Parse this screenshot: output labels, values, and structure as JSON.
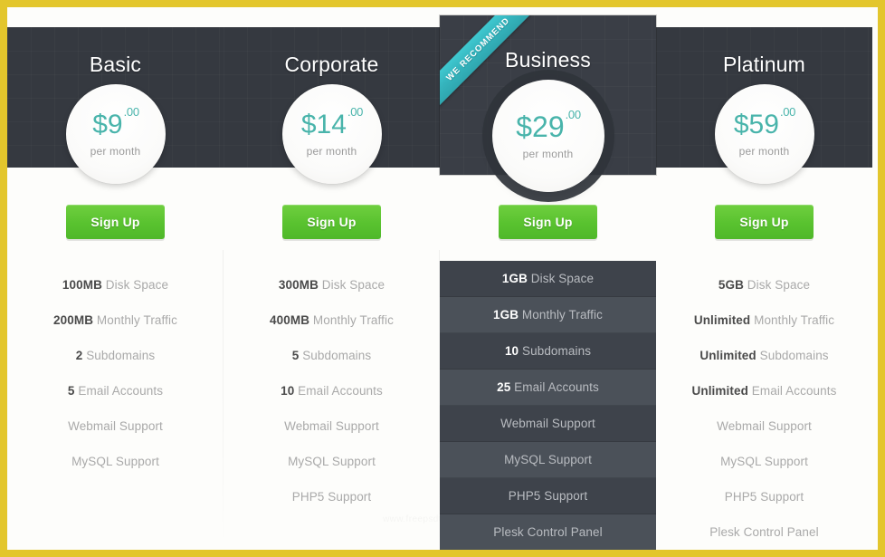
{
  "theme": {
    "page_border_color": "#e3c62c",
    "card_bg": "#fdfdfb",
    "header_dark": "#353940",
    "featured_header_dark": "#3a3e46",
    "price_teal": "#49b4ab",
    "signup_green": "#59c22f",
    "ribbon_teal": "#35b4bd",
    "feature_label_gray": "#a9a9a9",
    "feature_value_dark": "#4a4a4a"
  },
  "ribbon": {
    "label": "WE RECOMMEND"
  },
  "signup": {
    "label": "Sign Up"
  },
  "watermark": {
    "text": "www.freepsdtemplates.com"
  },
  "plans": [
    {
      "name": "Basic",
      "price_main": "$9",
      "price_cents": ".00",
      "price_period": "per month",
      "featured": false,
      "features": [
        {
          "value": "100MB",
          "label": " Disk Space"
        },
        {
          "value": "200MB",
          "label": " Monthly Traffic"
        },
        {
          "value": "2",
          "label": " Subdomains"
        },
        {
          "value": "5",
          "label": " Email Accounts"
        },
        {
          "value": "",
          "label": "Webmail Support"
        },
        {
          "value": "",
          "label": "MySQL Support"
        }
      ]
    },
    {
      "name": "Corporate",
      "price_main": "$14",
      "price_cents": ".00",
      "price_period": "per month",
      "featured": false,
      "features": [
        {
          "value": "300MB",
          "label": " Disk Space"
        },
        {
          "value": "400MB",
          "label": " Monthly Traffic"
        },
        {
          "value": "5",
          "label": " Subdomains"
        },
        {
          "value": "10",
          "label": " Email Accounts"
        },
        {
          "value": "",
          "label": "Webmail Support"
        },
        {
          "value": "",
          "label": "MySQL Support"
        },
        {
          "value": "",
          "label": "PHP5 Support"
        }
      ]
    },
    {
      "name": "Business",
      "price_main": "$29",
      "price_cents": ".00",
      "price_period": "per month",
      "featured": true,
      "features": [
        {
          "value": "1GB",
          "label": " Disk Space"
        },
        {
          "value": "1GB",
          "label": " Monthly Traffic"
        },
        {
          "value": "10",
          "label": " Subdomains"
        },
        {
          "value": "25",
          "label": " Email Accounts"
        },
        {
          "value": "",
          "label": "Webmail Support"
        },
        {
          "value": "",
          "label": "MySQL Support"
        },
        {
          "value": "",
          "label": "PHP5 Support"
        },
        {
          "value": "",
          "label": "Plesk Control Panel"
        }
      ]
    },
    {
      "name": "Platinum",
      "price_main": "$59",
      "price_cents": ".00",
      "price_period": "per month",
      "featured": false,
      "features": [
        {
          "value": "5GB",
          "label": " Disk Space"
        },
        {
          "value": "Unlimited",
          "label": " Monthly Traffic"
        },
        {
          "value": "Unlimited",
          "label": " Subdomains"
        },
        {
          "value": "Unlimited",
          "label": " Email Accounts"
        },
        {
          "value": "",
          "label": "Webmail Support"
        },
        {
          "value": "",
          "label": "MySQL Support"
        },
        {
          "value": "",
          "label": "PHP5 Support"
        },
        {
          "value": "",
          "label": "Plesk Control Panel"
        }
      ]
    }
  ]
}
